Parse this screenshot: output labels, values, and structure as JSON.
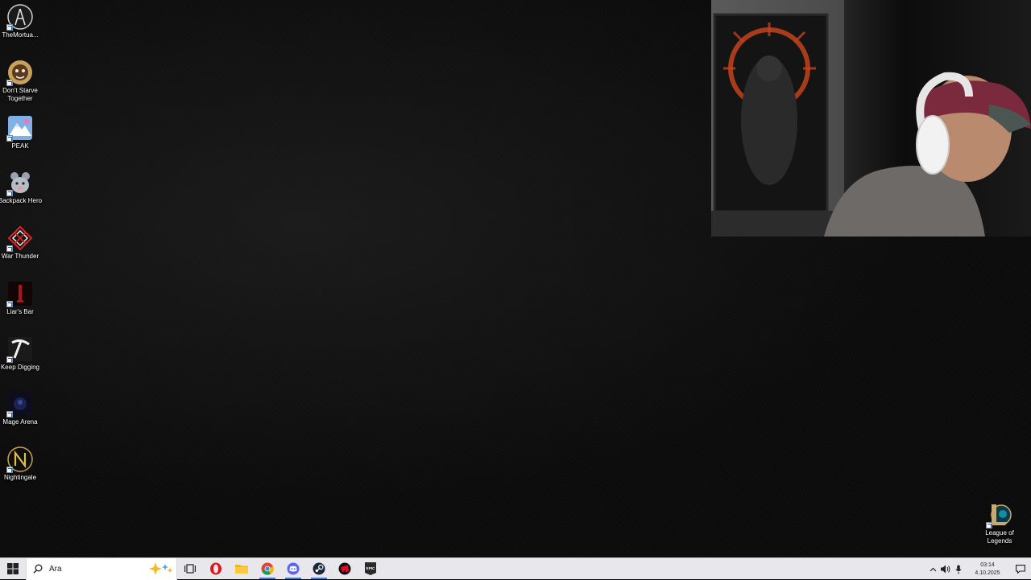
{
  "desktop": {
    "icons": [
      {
        "name": "TheMortua...",
        "icon": "mortuary-icon"
      },
      {
        "name": "Don't Starve Together",
        "icon": "dont-starve-icon"
      },
      {
        "name": "PEAK",
        "icon": "peak-icon"
      },
      {
        "name": "Backpack Hero",
        "icon": "backpack-hero-icon"
      },
      {
        "name": "War Thunder",
        "icon": "war-thunder-icon"
      },
      {
        "name": "Liar's Bar",
        "icon": "liars-bar-icon"
      },
      {
        "name": "Keep Digging",
        "icon": "keep-digging-icon"
      },
      {
        "name": "Mage Arena",
        "icon": "mage-arena-icon"
      },
      {
        "name": "Nightingale",
        "icon": "nightingale-icon"
      }
    ],
    "right_icon": {
      "name": "League of Legends",
      "icon": "league-of-legends-icon"
    }
  },
  "taskbar": {
    "search_placeholder": "Ara",
    "pinned": [
      "start-icon",
      "search-icon",
      "task-view-icon",
      "opera-icon",
      "file-explorer-icon",
      "chrome-icon",
      "discord-icon",
      "steam-icon",
      "riot-icon",
      "epic-games-icon"
    ],
    "clock": {
      "time": "03:14",
      "date": "4.10.2025"
    }
  },
  "colors": {
    "taskbar_bg": "#e8e8ec",
    "accent": "#3b7ad8",
    "opera": "#e0151b",
    "discord": "#5865f2",
    "steam": "#1b2838"
  }
}
